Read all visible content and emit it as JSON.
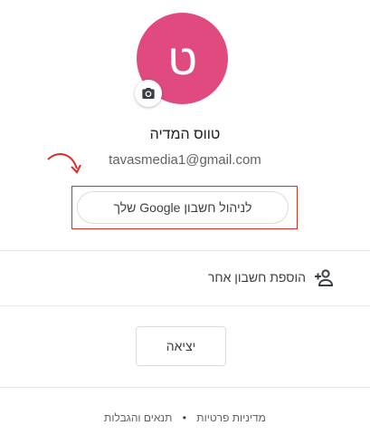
{
  "account": {
    "avatar_letter": "ט",
    "avatar_color": "#e04a7e",
    "name": "טווס המדיה",
    "email": "tavasmedia1@gmail.com",
    "manage_label": "לניהול חשבון Google שלך",
    "camera_icon": "camera-icon"
  },
  "menu": {
    "add_account_label": "הוספת חשבון אחר",
    "add_account_icon": "person-add-icon",
    "sign_out_label": "יציאה"
  },
  "footer": {
    "privacy_label": "מדיניות פרטיות",
    "separator": "•",
    "terms_label": "תנאים והגבלות"
  },
  "annotation": {
    "highlight_color": "#d93025"
  }
}
